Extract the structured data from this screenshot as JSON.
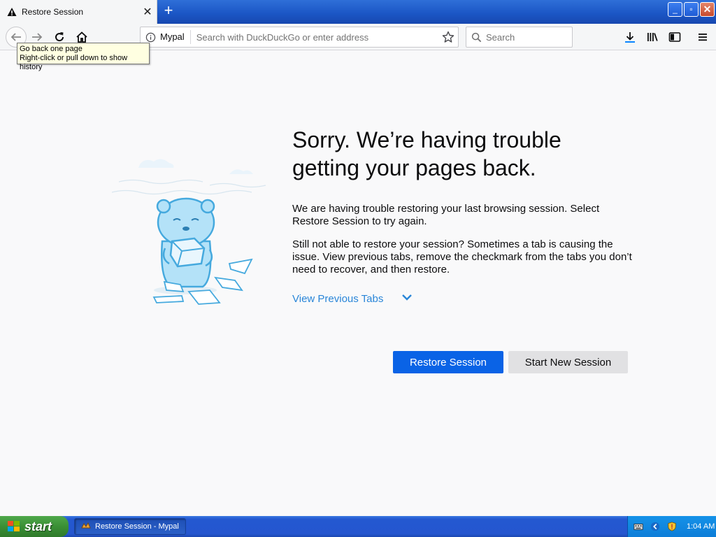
{
  "window": {
    "tab_title": "Restore Session",
    "new_tab_label": "+",
    "minimize_label": "_",
    "maximize_label": "▫",
    "close_label": "✕"
  },
  "toolbar": {
    "site_name": "Mypal",
    "address_placeholder": "Search with DuckDuckGo or enter address",
    "search_placeholder": "Search"
  },
  "tooltip": {
    "line1": "Go back one page",
    "line2": "Right-click or pull down to show history"
  },
  "content": {
    "heading": "Sorry. We’re having trouble getting your pages back.",
    "paragraph1": "We are having trouble restoring your last browsing session. Select Restore Session to try again.",
    "paragraph2": "Still not able to restore your session? Sometimes a tab is causing the issue. View previous tabs, remove the checkmark from the tabs you don’t need to recover, and then restore.",
    "view_tabs_label": "View Previous Tabs",
    "restore_button": "Restore Session",
    "new_session_button": "Start New Session"
  },
  "taskbar": {
    "start_label": "start",
    "task_item_label": "Restore Session - Mypal",
    "clock": "1:04 AM"
  },
  "colors": {
    "accent": "#0a63e6",
    "link": "#2a86d8",
    "taskbar": "#2556cf"
  }
}
